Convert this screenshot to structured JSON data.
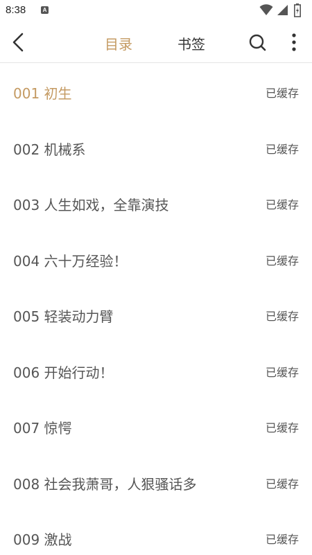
{
  "status_bar": {
    "time": "8:38",
    "notification_badge": "A",
    "icons": [
      "wifi-icon",
      "cellular-signal-icon",
      "battery-icon"
    ]
  },
  "header": {
    "back_icon": "chevron-left-icon",
    "tabs": [
      {
        "label": "目录",
        "active": true
      },
      {
        "label": "书签",
        "active": false
      }
    ],
    "search_icon": "search-icon",
    "more_icon": "more-vertical-icon"
  },
  "colors": {
    "accent": "#c49a62",
    "text": "#555555",
    "divider": "#e4e4e4"
  },
  "chapters": [
    {
      "title": "001 初生",
      "status": "已缓存",
      "current": true
    },
    {
      "title": "002 机械系",
      "status": "已缓存",
      "current": false
    },
    {
      "title": "003 人生如戏，全靠演技",
      "status": "已缓存",
      "current": false
    },
    {
      "title": "004 六十万经验！",
      "status": "已缓存",
      "current": false
    },
    {
      "title": "005 轻装动力臂",
      "status": "已缓存",
      "current": false
    },
    {
      "title": "006 开始行动！",
      "status": "已缓存",
      "current": false
    },
    {
      "title": "007 惊愕",
      "status": "已缓存",
      "current": false
    },
    {
      "title": "008 社会我萧哥，人狠骚话多",
      "status": "已缓存",
      "current": false
    },
    {
      "title": "009 激战",
      "status": "已缓存",
      "current": false
    }
  ]
}
